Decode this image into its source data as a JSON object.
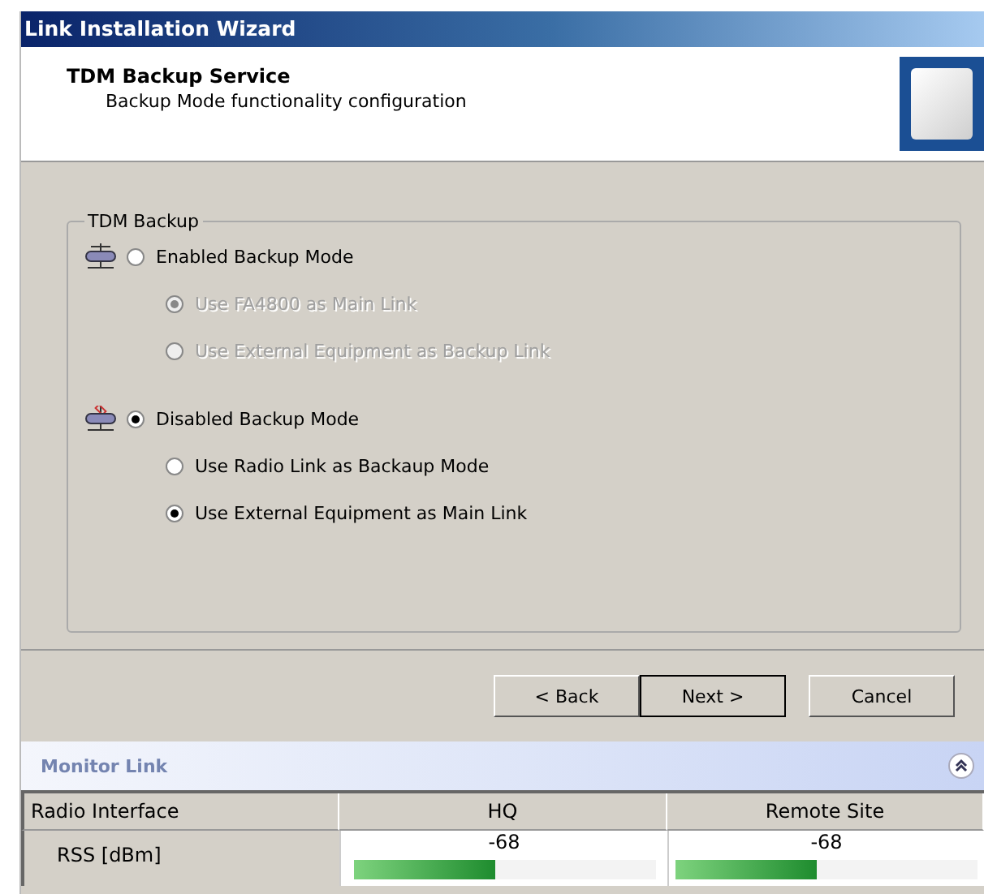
{
  "window": {
    "title": "Link Installation Wizard"
  },
  "header": {
    "title": "TDM Backup Service",
    "subtitle": "Backup Mode functionality configuration"
  },
  "group": {
    "title": "TDM Backup",
    "modes": [
      {
        "label": "Enabled Backup Mode",
        "selected": false,
        "disabled": false,
        "children": [
          {
            "label": "Use FA4800 as Main Link",
            "selected": true,
            "disabled": true
          },
          {
            "label": "Use External Equipment as Backup Link",
            "selected": false,
            "disabled": true
          }
        ]
      },
      {
        "label": "Disabled Backup Mode",
        "selected": true,
        "disabled": false,
        "children": [
          {
            "label": "Use Radio Link as Backaup Mode",
            "selected": false,
            "disabled": false
          },
          {
            "label": "Use External Equipment as Main Link",
            "selected": true,
            "disabled": false
          }
        ]
      }
    ]
  },
  "buttons": [
    {
      "label": "< Back",
      "default": false
    },
    {
      "label": "Next >",
      "default": true
    },
    {
      "label": "Cancel",
      "default": false
    }
  ],
  "monitor": {
    "title": "Monitor Link",
    "expanded": true,
    "columns": [
      "Radio Interface",
      "HQ",
      "Remote Site"
    ],
    "rows": [
      {
        "cells": [
          {
            "kind": "label",
            "text": "RSS [dBm]"
          },
          {
            "kind": "meter",
            "reading": "-68",
            "level": 0.47
          },
          {
            "kind": "meter",
            "reading": "-68",
            "level": 0.47
          }
        ]
      }
    ]
  }
}
